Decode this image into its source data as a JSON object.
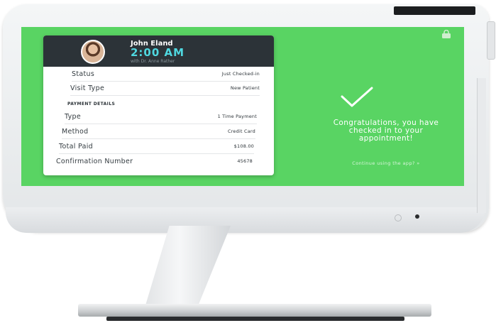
{
  "card": {
    "patient_name": "John Eland",
    "time": "2:00 AM",
    "doctor": "with Dr. Anne Rather",
    "rows": [
      {
        "label": "Status",
        "value": "Just Checked-in"
      },
      {
        "label": "Visit Type",
        "value": "New Patient"
      }
    ],
    "payment_heading": "PAYMENT DETAILS",
    "payment_rows": [
      {
        "label": "Type",
        "value": "1 Time Payment"
      },
      {
        "label": "Method",
        "value": "Credit Card"
      },
      {
        "label": "Total Paid",
        "value": "$108.00"
      },
      {
        "label": "Confirmation Number",
        "value": "45678"
      }
    ]
  },
  "message": {
    "line1": "Congratulations, you have",
    "line2": "checked in to your",
    "line3": "appointment!",
    "continue_link": "Continue using the app? »"
  },
  "icons": {
    "lock": "lock-icon",
    "checkmark": "checkmark-icon",
    "avatar": "avatar"
  },
  "colors": {
    "screen_bg": "#59d463",
    "card_header": "#2c3338",
    "time_accent": "#4fd8e0"
  }
}
